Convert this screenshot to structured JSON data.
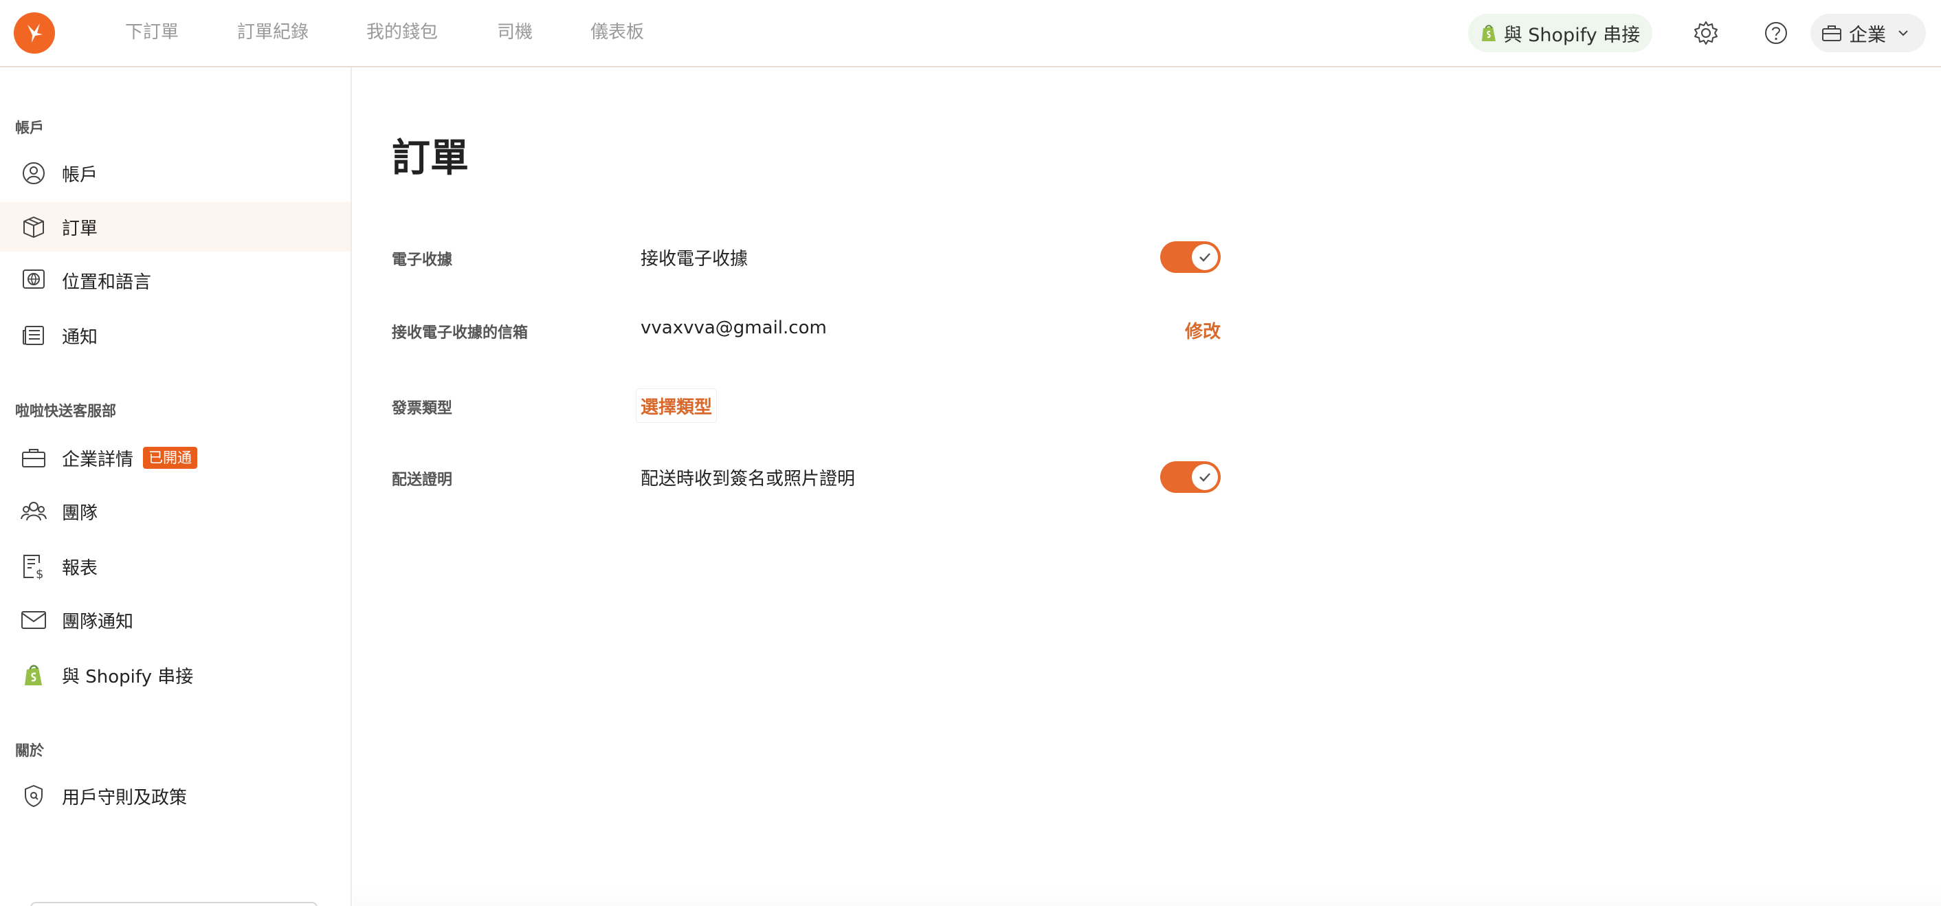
{
  "topnav": {
    "items": [
      "下訂單",
      "訂單紀錄",
      "我的錢包",
      "司機",
      "儀表板"
    ],
    "shopify_label": "與 Shopify 串接",
    "business_label": "企業"
  },
  "sidebar": {
    "section_account": "帳戶",
    "account_items": [
      "帳戶",
      "訂單",
      "位置和語言",
      "通知"
    ],
    "section_business": "啦啦快送客服部",
    "business_items": [
      "企業詳情",
      "團隊",
      "報表",
      "團隊通知",
      "與 Shopify 串接"
    ],
    "business_badge": "已開通",
    "section_about": "關於",
    "about_items": [
      "用戶守則及政策"
    ]
  },
  "main": {
    "title": "訂單",
    "rows": {
      "e_receipt_label": "電子收據",
      "e_receipt_value": "接收電子收據",
      "e_receipt_enabled": true,
      "email_label": "接收電子收據的信箱",
      "email_value": "vvaxvva@gmail.com",
      "email_action": "修改",
      "invoice_label": "發票類型",
      "invoice_action": "選擇類型",
      "pod_label": "配送證明",
      "pod_value": "配送時收到簽名或照片證明",
      "pod_enabled": true
    }
  },
  "colors": {
    "accent": "#e8692c",
    "brand_logo": "#f16622",
    "active_bg": "#fdf5f0",
    "shopify_green": "#95bf47"
  },
  "icons": {
    "logo": "lalamove-bird-logo",
    "settings": "gear-icon",
    "help": "question-circle-icon",
    "business": "briefcase-icon",
    "dropdown": "chevron-down-icon"
  }
}
